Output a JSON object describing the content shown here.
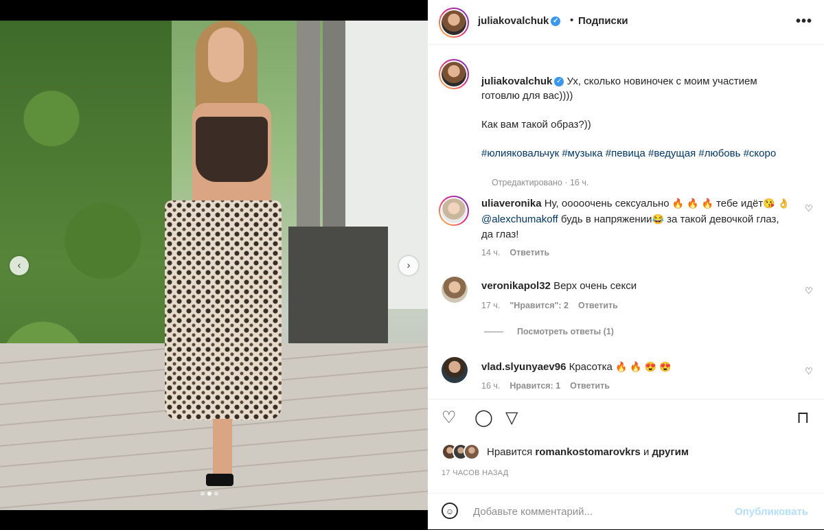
{
  "post": {
    "username": "juliakovalchuk",
    "follow_label": "Подписки",
    "separator": "•",
    "more": "•••",
    "caption_lines": [
      "Ух, сколько новиночек с моим участием готовлю для вас))))"
    ],
    "caption_q": "Как вам такой образ?))",
    "hashtags": "#юлияковальчук #музыка #певица #ведущая #любовь #скоро",
    "edited": "Отредактировано · 16 ч."
  },
  "comments": [
    {
      "user": "uliaveronika",
      "text_a": "Ну, ооооочень сексуально",
      "emoji_a": "🔥 🔥 🔥",
      "text_b": "тебе идёт",
      "emoji_b": "😘",
      "emoji_c": "👌",
      "mention": "@alexchumakoff",
      "text_c": "будь в напряжении",
      "emoji_d": "😂",
      "text_d": "за такой девочкой глаз, да глаз!",
      "time": "14 ч.",
      "reply": "Ответить"
    },
    {
      "user": "veronikapol32",
      "text": "Верх очень секси",
      "time": "17 ч.",
      "likes": "\"Нравится\": 2",
      "reply": "Ответить"
    },
    {
      "user": "vlad.slyunyaev96",
      "text": "Красотка",
      "emoji": "🔥 🔥 😍 😍",
      "time": "16 ч.",
      "likes": "Нравится: 1",
      "reply": "Ответить"
    }
  ],
  "view_replies": "Посмотреть ответы (1)",
  "likes": {
    "prefix": "Нравится",
    "user": "romankostomarovkrs",
    "and": "и",
    "others": "другим"
  },
  "timestamp": "17 ЧАСОВ НАЗАД",
  "composer": {
    "placeholder": "Добавьте комментарий...",
    "publish": "Опубликовать"
  },
  "icons": {
    "heart": "♡",
    "comment": "◯",
    "share": "▽",
    "bookmark": "⊓",
    "prev": "‹",
    "next": "›",
    "emoji": "☺"
  },
  "colors": {
    "accent": "#0095f6",
    "link": "#00376b",
    "muted": "#8e8e8e"
  },
  "carousel": {
    "slides": 3,
    "current": 1
  }
}
